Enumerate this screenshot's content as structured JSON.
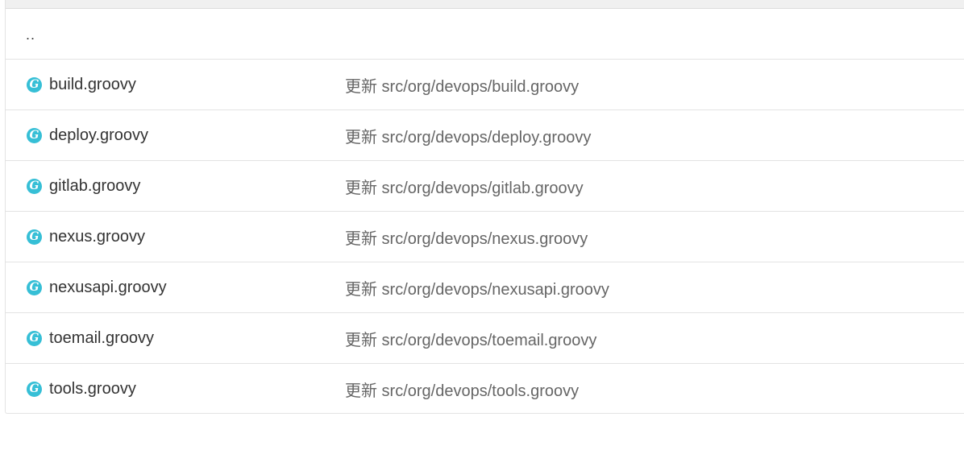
{
  "table": {
    "parent_link": "..",
    "rows": [
      {
        "name": "build.groovy",
        "commit": "更新 src/org/devops/build.groovy"
      },
      {
        "name": "deploy.groovy",
        "commit": "更新 src/org/devops/deploy.groovy"
      },
      {
        "name": "gitlab.groovy",
        "commit": "更新 src/org/devops/gitlab.groovy"
      },
      {
        "name": "nexus.groovy",
        "commit": "更新 src/org/devops/nexus.groovy"
      },
      {
        "name": "nexusapi.groovy",
        "commit": "更新 src/org/devops/nexusapi.groovy"
      },
      {
        "name": "toemail.groovy",
        "commit": "更新 src/org/devops/toemail.groovy"
      },
      {
        "name": "tools.groovy",
        "commit": "更新 src/org/devops/tools.groovy"
      }
    ],
    "icon": "groovy-file-icon",
    "icon_color": "#36bfd6"
  }
}
